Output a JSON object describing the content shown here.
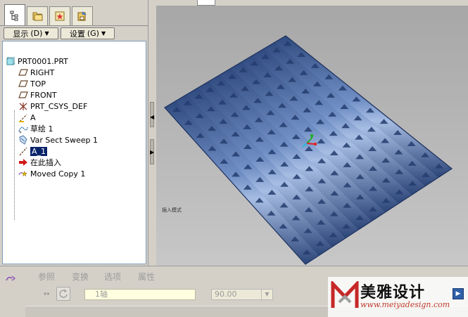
{
  "toolbar_buttons": {
    "show_label": "显示",
    "show_key": "(D)",
    "settings_label": "设置",
    "settings_key": "(G)"
  },
  "model_tree": {
    "root": "PRT0001.PRT",
    "items": [
      {
        "label": "RIGHT",
        "icon": "datum-plane-icon"
      },
      {
        "label": "TOP",
        "icon": "datum-plane-icon"
      },
      {
        "label": "FRONT",
        "icon": "datum-plane-icon"
      },
      {
        "label": "PRT_CSYS_DEF",
        "icon": "csys-icon"
      },
      {
        "label": "A",
        "icon": "datum-axis-icon"
      },
      {
        "label": "草绘 1",
        "icon": "sketch-icon"
      },
      {
        "label": "Var Sect Sweep 1",
        "icon": "sweep-icon"
      },
      {
        "label": "A_1",
        "icon": "datum-axis-icon",
        "selected": true
      },
      {
        "label": "在此插入",
        "icon": "insert-arrow-icon"
      },
      {
        "label": "Moved Copy 1",
        "icon": "moved-copy-icon"
      }
    ]
  },
  "viewport": {
    "annotation": "插入模式"
  },
  "dashboard": {
    "tabs": [
      "参照",
      "变换",
      "选项",
      "属性"
    ],
    "axis_field": "1轴",
    "angle_value": "90.00"
  },
  "watermark": {
    "brand": "美雅设计",
    "url": "www.meiyadesign.com"
  },
  "colors": {
    "surface": "#3e5c94",
    "selected_bg": "#0a246a",
    "tree_bg": "#ffffff"
  }
}
